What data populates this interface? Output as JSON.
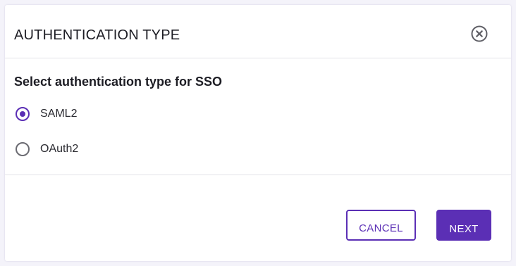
{
  "dialog": {
    "title": "AUTHENTICATION TYPE",
    "close_icon": "close-circle-icon",
    "prompt": "Select authentication type for SSO",
    "options": [
      {
        "label": "SAML2",
        "selected": true
      },
      {
        "label": "OAuth2",
        "selected": false
      }
    ],
    "buttons": {
      "cancel_label": "CANCEL",
      "next_label": "NEXT"
    }
  },
  "colors": {
    "accent": "#5b2fb5",
    "text": "#1d1d24",
    "divider": "#e3e3e8",
    "radio_unselected": "#6b6b72",
    "background": "#f4f3fa"
  }
}
